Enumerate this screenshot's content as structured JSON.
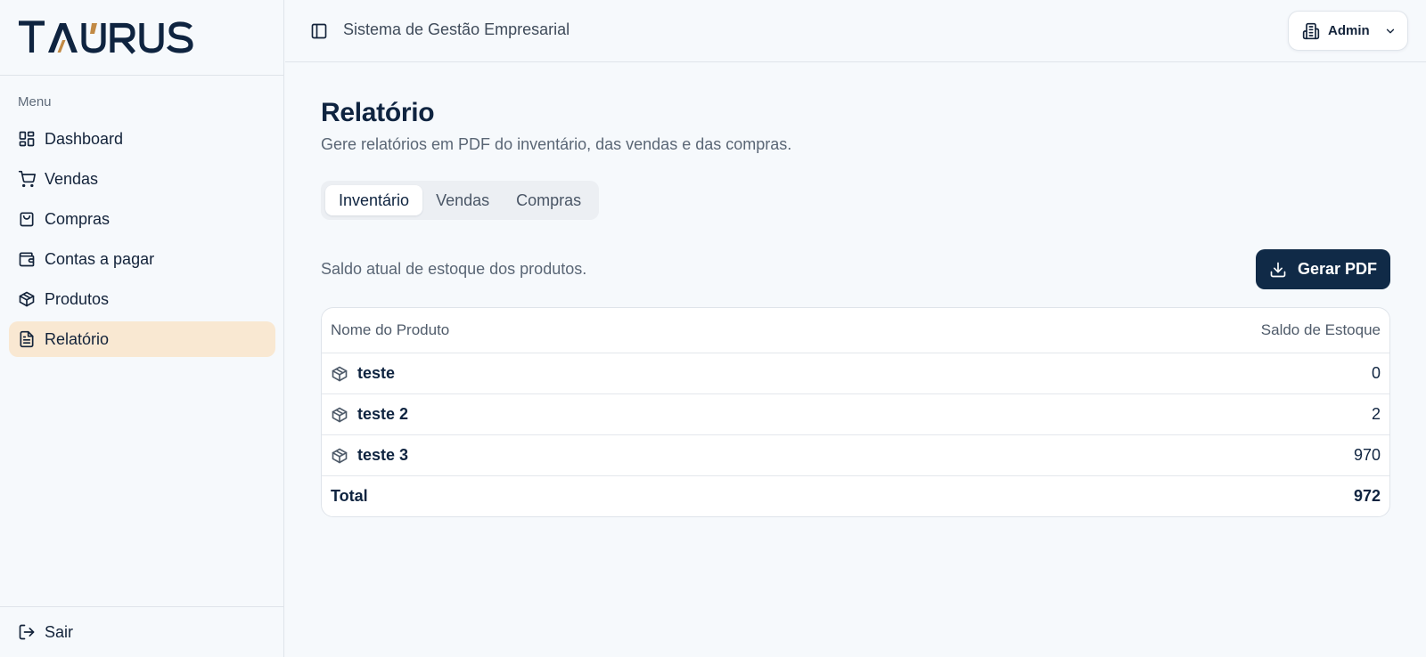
{
  "brand": {
    "name": "TAURUS",
    "accent": "#c28a45",
    "dark": "#0f2440"
  },
  "sidebar": {
    "menu_label": "Menu",
    "items": [
      {
        "label": "Dashboard",
        "icon": "dashboard-icon"
      },
      {
        "label": "Vendas",
        "icon": "cart-icon"
      },
      {
        "label": "Compras",
        "icon": "shopping-bag-icon"
      },
      {
        "label": "Contas a pagar",
        "icon": "wallet-icon"
      },
      {
        "label": "Produtos",
        "icon": "package-icon"
      },
      {
        "label": "Relatório",
        "icon": "file-text-icon",
        "active": true
      }
    ],
    "logout_label": "Sair"
  },
  "header": {
    "title": "Sistema de Gestão Empresarial",
    "user_label": "Admin"
  },
  "page": {
    "title": "Relatório",
    "subtitle": "Gere relatórios em PDF do inventário, das vendas e das compras.",
    "tabs": [
      {
        "label": "Inventário",
        "active": true
      },
      {
        "label": "Vendas"
      },
      {
        "label": "Compras"
      }
    ],
    "section_description": "Saldo atual de estoque dos produtos.",
    "pdf_button_label": "Gerar PDF"
  },
  "table": {
    "columns": [
      "Nome do Produto",
      "Saldo de Estoque"
    ],
    "rows": [
      {
        "name": "teste",
        "stock": "0"
      },
      {
        "name": "teste 2",
        "stock": "2"
      },
      {
        "name": "teste 3",
        "stock": "970"
      }
    ],
    "total_label": "Total",
    "total_value": "972"
  }
}
